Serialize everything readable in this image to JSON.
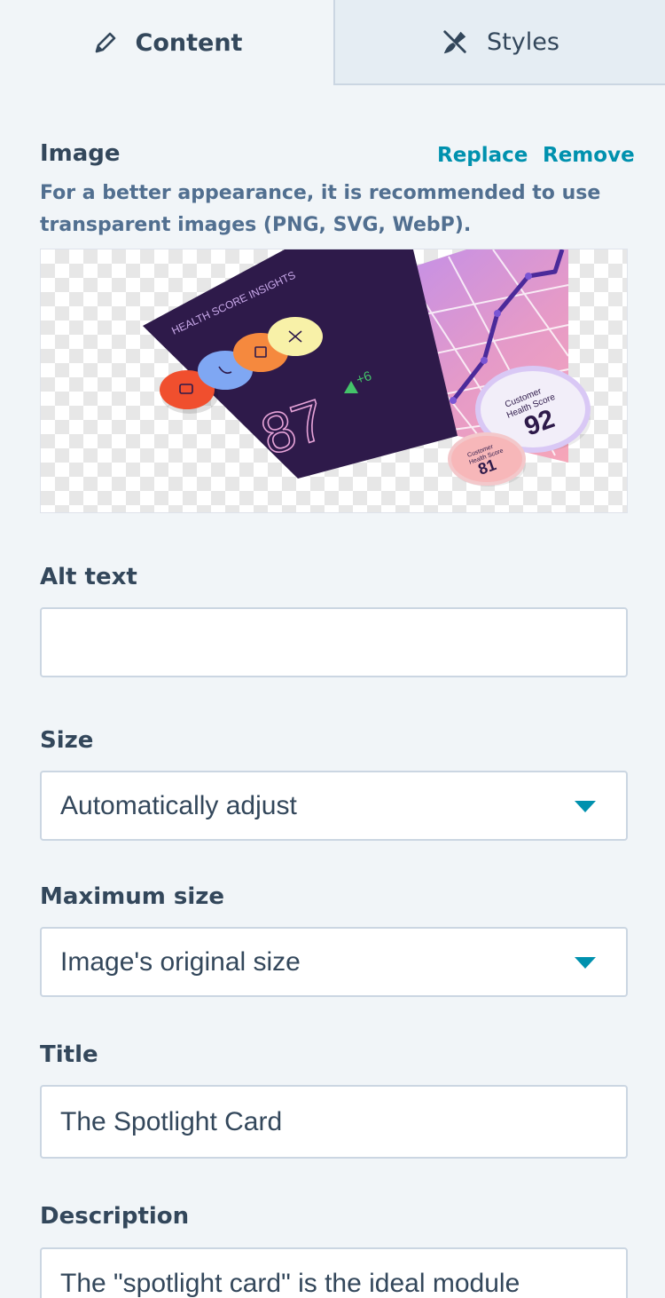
{
  "tabs": [
    {
      "label": "Content",
      "icon": "pencil-icon",
      "active": true
    },
    {
      "label": "Styles",
      "icon": "brush-icon",
      "active": false
    }
  ],
  "image": {
    "label": "Image",
    "replace": "Replace",
    "remove": "Remove",
    "help": "For a better appearance, it is recommended to use transparent images (PNG, SVG, WebP).",
    "preview": {
      "card_title": "HEALTH SCORE INSIGHTS",
      "score": "87",
      "delta": "+6",
      "badge_large_label_1": "Customer",
      "badge_large_label_2": "Health Score",
      "badge_large_value": "92",
      "badge_small_label_1": "Customer",
      "badge_small_label_2": "Health Score",
      "badge_small_value": "81"
    }
  },
  "alt_text": {
    "label": "Alt text",
    "value": ""
  },
  "size": {
    "label": "Size",
    "value": "Automatically adjust"
  },
  "max_size": {
    "label": "Maximum size",
    "value": "Image's original size"
  },
  "title": {
    "label": "Title",
    "value": "The Spotlight Card"
  },
  "description": {
    "label": "Description",
    "value": "The \"spotlight card\" is the ideal module"
  },
  "colors": {
    "accent": "#0091ae",
    "text": "#33475b",
    "background": "#f1f5f8"
  }
}
